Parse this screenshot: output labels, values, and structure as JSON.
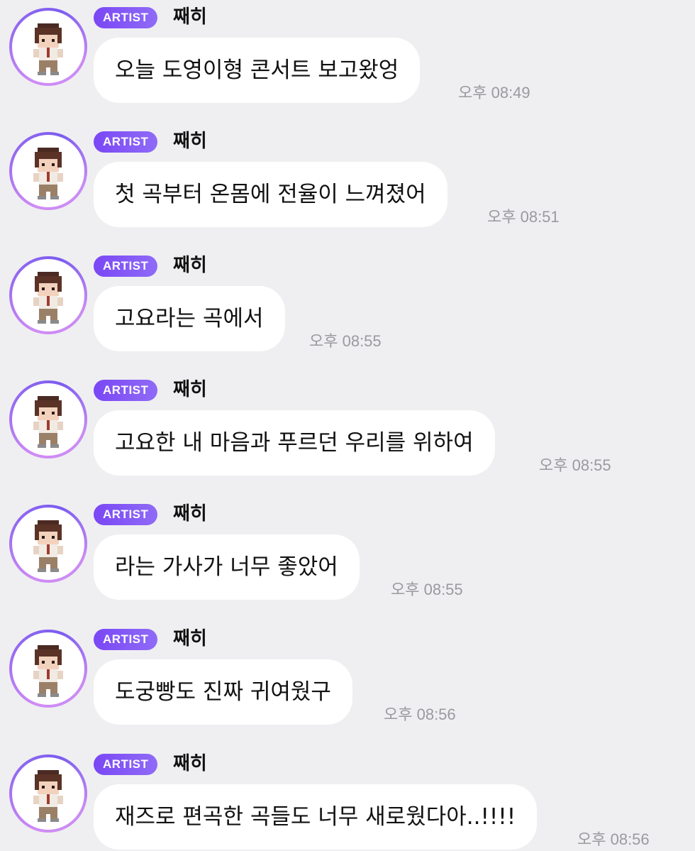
{
  "messages": [
    {
      "badge": "ARTIST",
      "sender": "째히",
      "text": "오늘 도영이형 콘서트 보고왔엉",
      "time": "오후 08:49",
      "avatar": "pixel-character-avatar"
    },
    {
      "badge": "ARTIST",
      "sender": "째히",
      "text": "첫 곡부터 온몸에 전율이 느껴졌어",
      "time": "오후 08:51",
      "avatar": "pixel-character-avatar"
    },
    {
      "badge": "ARTIST",
      "sender": "째히",
      "text": "고요라는 곡에서",
      "time": "오후 08:55",
      "avatar": "pixel-character-avatar"
    },
    {
      "badge": "ARTIST",
      "sender": "째히",
      "text": "고요한 내 마음과 푸르던 우리를 위하여",
      "time": "오후 08:55",
      "avatar": "pixel-character-avatar"
    },
    {
      "badge": "ARTIST",
      "sender": "째히",
      "text": "라는 가사가 너무 좋았어",
      "time": "오후 08:55",
      "avatar": "pixel-character-avatar"
    },
    {
      "badge": "ARTIST",
      "sender": "째히",
      "text": "도궁빵도 진짜 귀여웠구",
      "time": "오후 08:56",
      "avatar": "pixel-character-avatar"
    },
    {
      "badge": "ARTIST",
      "sender": "째히",
      "text": "재즈로 편곡한 곡들도 너무 새로웠다아..!!!!",
      "time": "오후 08:56",
      "avatar": "pixel-character-avatar"
    }
  ],
  "colors": {
    "background": "#efeff1",
    "bubble": "#ffffff",
    "badge_start": "#7a47f5",
    "badge_end": "#8f6bf7",
    "timestamp": "#9a9a9f",
    "avatar_ring": "#9a6cf0"
  }
}
